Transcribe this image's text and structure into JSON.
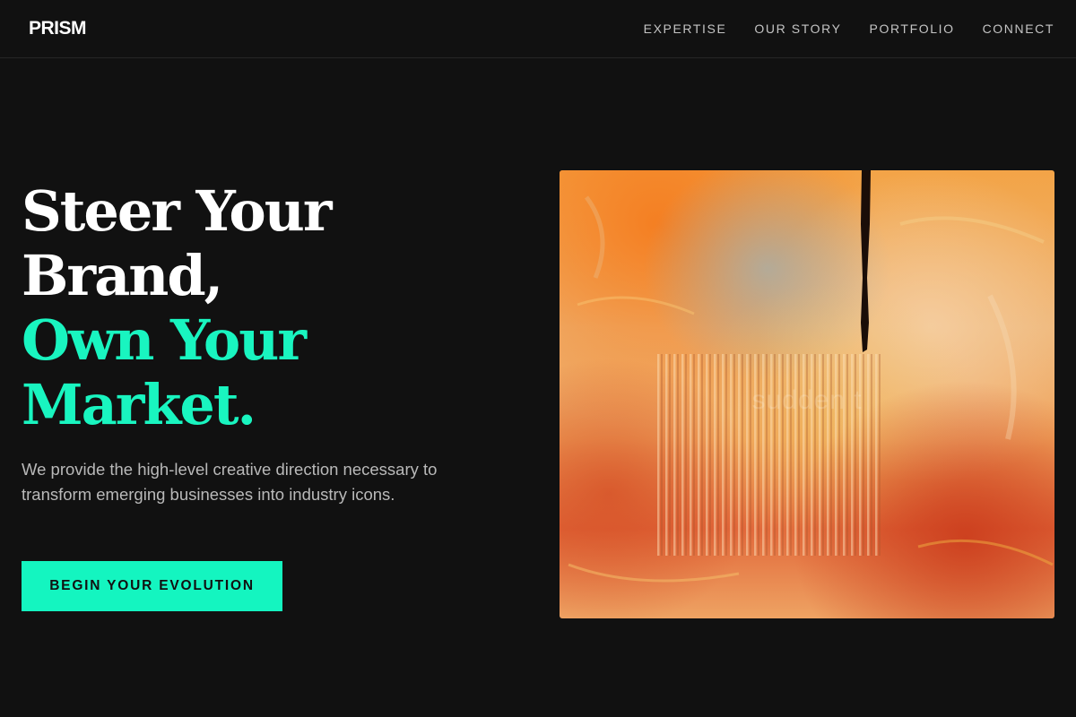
{
  "header": {
    "logo": "PRISM",
    "nav": [
      {
        "label": "EXPERTISE"
      },
      {
        "label": "OUR STORY"
      },
      {
        "label": "PORTFOLIO"
      },
      {
        "label": "CONNECT"
      }
    ]
  },
  "hero": {
    "headline_white": [
      "Steer Your",
      "Brand,"
    ],
    "headline_accent": [
      "Own Your",
      "Market."
    ],
    "subtext": "We provide the high-level creative direction necessary to transform emerging businesses into industry icons.",
    "cta_label": "BEGIN YOUR EVOLUTION"
  },
  "artwork": {
    "watermark": "sudden t"
  },
  "colors": {
    "background": "#111111",
    "accent": "#14f5c0",
    "text_primary": "#ffffff",
    "text_secondary": "#b9b9b9"
  }
}
